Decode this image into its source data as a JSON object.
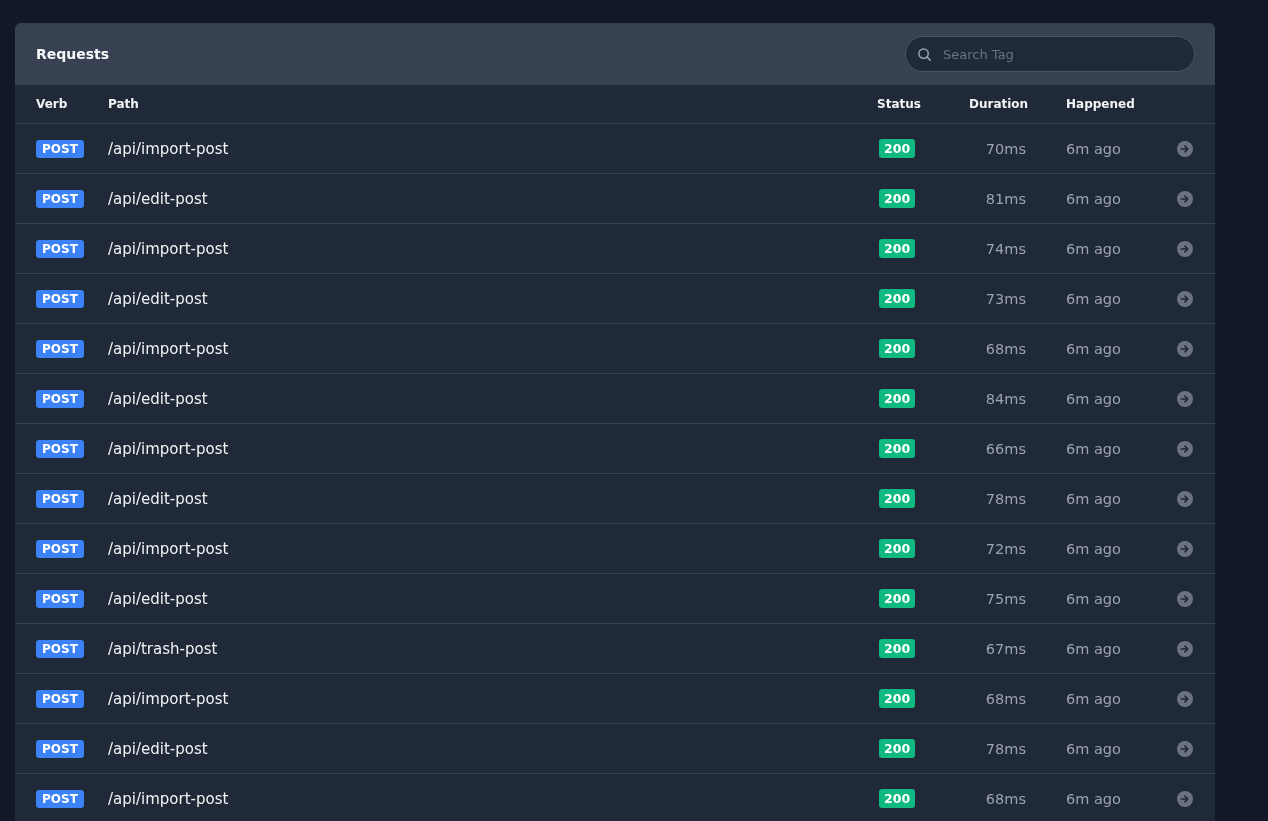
{
  "panel": {
    "title": "Requests",
    "search": {
      "placeholder": "Search Tag"
    }
  },
  "table": {
    "columns": [
      "Verb",
      "Path",
      "Status",
      "Duration",
      "Happened"
    ],
    "rows": [
      {
        "verb": "POST",
        "path": "/api/import-post",
        "status": "200",
        "duration": "70ms",
        "happened": "6m ago"
      },
      {
        "verb": "POST",
        "path": "/api/edit-post",
        "status": "200",
        "duration": "81ms",
        "happened": "6m ago"
      },
      {
        "verb": "POST",
        "path": "/api/import-post",
        "status": "200",
        "duration": "74ms",
        "happened": "6m ago"
      },
      {
        "verb": "POST",
        "path": "/api/edit-post",
        "status": "200",
        "duration": "73ms",
        "happened": "6m ago"
      },
      {
        "verb": "POST",
        "path": "/api/import-post",
        "status": "200",
        "duration": "68ms",
        "happened": "6m ago"
      },
      {
        "verb": "POST",
        "path": "/api/edit-post",
        "status": "200",
        "duration": "84ms",
        "happened": "6m ago"
      },
      {
        "verb": "POST",
        "path": "/api/import-post",
        "status": "200",
        "duration": "66ms",
        "happened": "6m ago"
      },
      {
        "verb": "POST",
        "path": "/api/edit-post",
        "status": "200",
        "duration": "78ms",
        "happened": "6m ago"
      },
      {
        "verb": "POST",
        "path": "/api/import-post",
        "status": "200",
        "duration": "72ms",
        "happened": "6m ago"
      },
      {
        "verb": "POST",
        "path": "/api/edit-post",
        "status": "200",
        "duration": "75ms",
        "happened": "6m ago"
      },
      {
        "verb": "POST",
        "path": "/api/trash-post",
        "status": "200",
        "duration": "67ms",
        "happened": "6m ago"
      },
      {
        "verb": "POST",
        "path": "/api/import-post",
        "status": "200",
        "duration": "68ms",
        "happened": "6m ago"
      },
      {
        "verb": "POST",
        "path": "/api/edit-post",
        "status": "200",
        "duration": "78ms",
        "happened": "6m ago"
      },
      {
        "verb": "POST",
        "path": "/api/import-post",
        "status": "200",
        "duration": "68ms",
        "happened": "6m ago"
      }
    ]
  }
}
